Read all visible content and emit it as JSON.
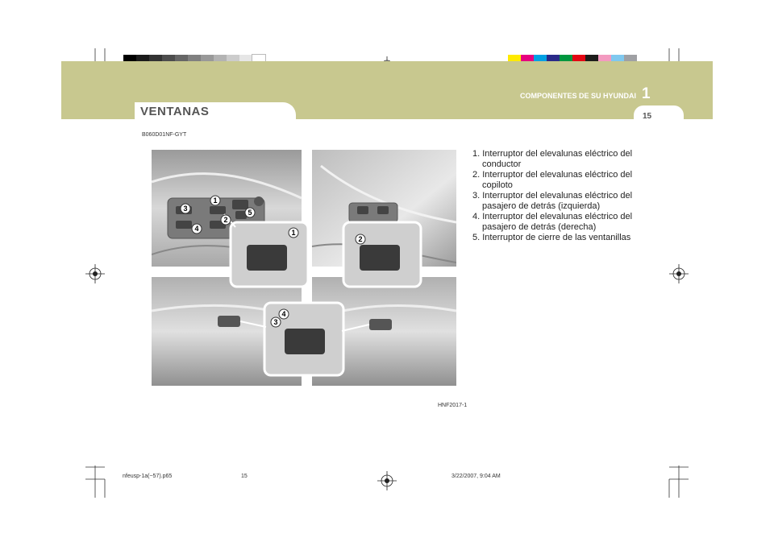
{
  "header": {
    "chapter_title": "COMPONENTES DE SU HYUNDAI",
    "chapter_number": "1",
    "page_number": "15",
    "section_title": "VENTANAS"
  },
  "doc_code": "B060D01NF-GYT",
  "figure": {
    "id": "HNF2017-1",
    "callouts": [
      "1",
      "2",
      "3",
      "4",
      "5"
    ]
  },
  "items": [
    "1. Interruptor del elevalunas eléctrico del conductor",
    "2. Interruptor del elevalunas eléctrico del copiloto",
    "3. Interruptor del elevalunas eléctrico del pasajero de detrás (izquierda)",
    "4. Interruptor del elevalunas eléctrico del pasajero de detrás (derecha)",
    "5. Interruptor de cierre de las ventanillas"
  ],
  "footer": {
    "file": "nfeusp-1a(~57).p65",
    "page": "15",
    "datetime": "3/22/2007, 9:04 AM"
  },
  "colors": {
    "band": "#c8c88f",
    "gray_strip": [
      "#000000",
      "#1b1b1b",
      "#333333",
      "#4d4d4d",
      "#666666",
      "#808080",
      "#999999",
      "#b3b3b3",
      "#cccccc",
      "#e6e6e6",
      "#ffffff"
    ],
    "color_strip": [
      "#ffea00",
      "#e6007e",
      "#00a0e3",
      "#2a2a88",
      "#00963f",
      "#e30613",
      "#1d1d1b",
      "#f39ac0",
      "#7fc8ef",
      "#9fa0a4"
    ]
  }
}
